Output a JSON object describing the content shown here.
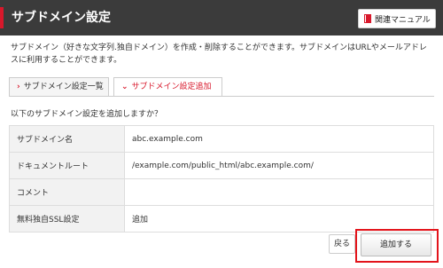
{
  "header": {
    "title": "サブドメイン設定",
    "manual_button": "関連マニュアル",
    "manual_icon": "book-icon",
    "accent_color": "#d8182b"
  },
  "description": "サブドメイン（好きな文字列.独自ドメイン）を作成・削除することができます。サブドメインはURLやメールアドレスに利用することができます。",
  "tabs": [
    {
      "label": "サブドメイン設定一覧",
      "active": false,
      "icon": "chevron-right-icon"
    },
    {
      "label": "サブドメイン設定追加",
      "active": true,
      "icon": "chevron-down-icon"
    }
  ],
  "question": "以下のサブドメイン設定を追加しますか？",
  "form": {
    "rows": [
      {
        "label": "サブドメイン名",
        "value": "abc.example.com"
      },
      {
        "label": "ドキュメントルート",
        "value": "/example.com/public_html/abc.example.com/"
      },
      {
        "label": "コメント",
        "value": ""
      },
      {
        "label": "無料独自SSL設定",
        "value": "追加"
      }
    ]
  },
  "actions": {
    "back_label": "戻る",
    "add_label": "追加する"
  }
}
